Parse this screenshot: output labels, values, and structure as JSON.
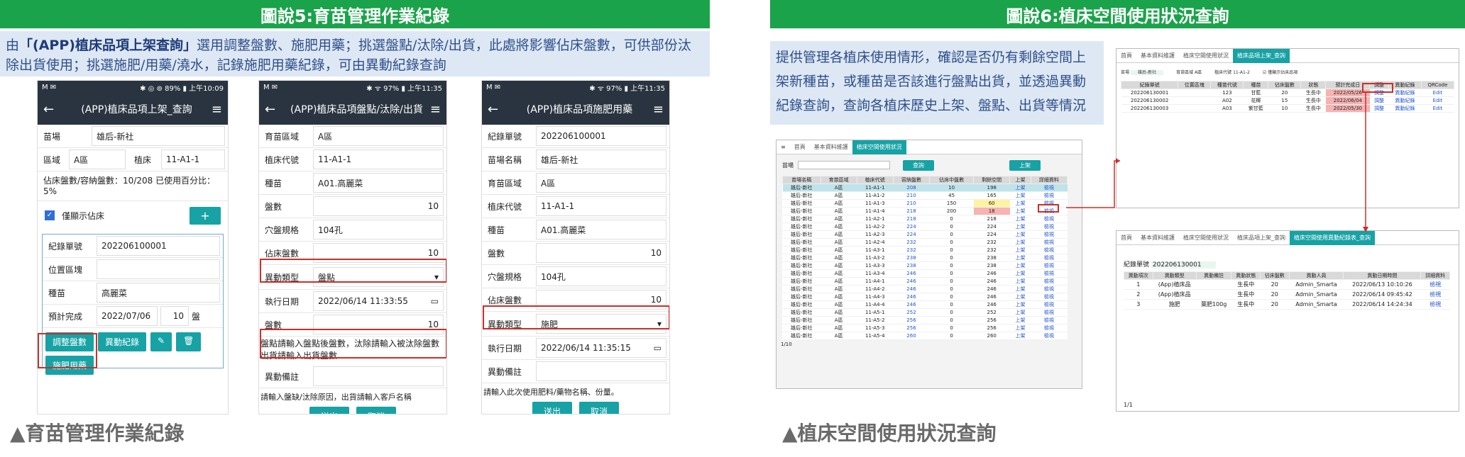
{
  "left": {
    "header": "圖說5:育苗管理作業紀錄",
    "intro_html_pre": "由",
    "intro_bold": "「(APP)植床品項上架查詢」",
    "intro_rest": "選用調整盤數、施肥用藥；挑選盤點/汰除/出貨，此處將影響佔床盤數，可供部份汰除出貨使用；挑選施肥/用藥/澆水，記錄施肥用藥紀錄，可由異動紀錄查詢",
    "caption": "▲育苗管理作業紀錄"
  },
  "right": {
    "header": "圖說6:植床空間使用狀況查詢",
    "intro": "提供管理各植床使用情形，確認是否仍有剩餘空間上架新種苗，或種苗是否該進行盤點出貨，並透過異動紀錄查詢，查詢各植床歷史上架、盤點、出貨等情況",
    "caption": "▲植床空間使用狀況查詢"
  },
  "phone1": {
    "status_left": "M ✉",
    "status_right": "✱ ◎ ⊚ 89% ▮ 上午10:09",
    "title": "(APP)植床品項上架_查詢",
    "farm_label": "苗場",
    "farm": "雄后-新社",
    "zone_label": "區域",
    "zone": "A區",
    "bed_label": "植床",
    "bed": "11-A1-1",
    "usage": "佔床盤數/容納盤數：10/208 已使用百分比：5%",
    "only_label": "僅顯示佔床",
    "plus": "+",
    "rec_label": "紀錄單號",
    "rec": "202206100001",
    "loc_label": "位置區塊",
    "loc": "",
    "seed_label": "種苗",
    "seed": "高麗菜",
    "due_label": "預計完成",
    "due": "2022/07/06",
    "qty": "10",
    "unit": "盤",
    "btn_adjust": "調整盤數",
    "btn_log": "異動紀錄",
    "btn_fert": "施肥用藥",
    "edit_icon": "✎",
    "del_icon": "🗑"
  },
  "phone2": {
    "status_left": "M ✉",
    "status_right": "✱ ᯤ 97% ▮ 上午11:35",
    "title": "(APP)植床品項盤點/汰除/出貨",
    "rows": [
      {
        "l": "育苗區域",
        "v": "A區"
      },
      {
        "l": "植床代號",
        "v": "11-A1-1"
      },
      {
        "l": "種苗",
        "v": "A01.高麗菜"
      },
      {
        "l": "盤數",
        "v": "10"
      },
      {
        "l": "穴盤規格",
        "v": "104孔"
      },
      {
        "l": "佔床盤數",
        "v": "10"
      }
    ],
    "type_label": "異動類型",
    "type": "盤點",
    "date_label": "執行日期",
    "date": "2022/06/14 11:33:55",
    "cnt_label": "盤數",
    "cnt": "10",
    "note": "盤點請輸入盤點後盤數，汰除請輸入被汰除盤數出貨請輸入出貨盤數",
    "memo_label": "異動備註",
    "hint": "請輸入盤缺/汰除原因，出貨請輸入客戶名稱",
    "submit": "送出",
    "cancel": "取消"
  },
  "phone3": {
    "status_left": "M ✉",
    "status_right": "✱ ᯤ 97% ▮ 上午11:35",
    "title": "(APP)植床品項施肥用藥",
    "rows": [
      {
        "l": "紀錄單號",
        "v": "202206100001"
      },
      {
        "l": "苗場名稱",
        "v": "雄后-新社"
      },
      {
        "l": "育苗區域",
        "v": "A區"
      },
      {
        "l": "植床代號",
        "v": "11-A1-1"
      },
      {
        "l": "種苗",
        "v": "A01.高麗菜"
      },
      {
        "l": "盤數",
        "v": "10"
      },
      {
        "l": "穴盤規格",
        "v": "104孔"
      },
      {
        "l": "佔床盤數",
        "v": "10"
      }
    ],
    "type_label": "異動類型",
    "type": "施肥",
    "date_label": "執行日期",
    "date": "2022/06/14 11:35:15",
    "memo_label": "異動備註",
    "hint": "請輸入此次使用肥料/藥物名稱、份量。",
    "submit": "送出",
    "cancel": "取消"
  },
  "grid": {
    "tab1": "首頁",
    "tab2": "基本資料維護",
    "tab3": "植床空間使用狀況",
    "field": "苗場",
    "query": "查詢",
    "shelf": "上架",
    "cols": [
      "苗場名稱",
      "育苗區域",
      "植床代號",
      "容納盤數",
      "佔床中盤數",
      "剩餘空間",
      "上架",
      "詳細資料"
    ],
    "rows": [
      [
        "雄后-新社",
        "A區",
        "11-A1-1",
        "208",
        "10",
        "198"
      ],
      [
        "雄后-新社",
        "A區",
        "11-A1-2",
        "210",
        "45",
        "165"
      ],
      [
        "雄后-新社",
        "A區",
        "11-A1-3",
        "210",
        "150",
        "60"
      ],
      [
        "雄后-新社",
        "A區",
        "11-A1-4",
        "218",
        "200",
        "18"
      ],
      [
        "雄后-新社",
        "A區",
        "11-A2-1",
        "218",
        "0",
        "218"
      ],
      [
        "雄后-新社",
        "A區",
        "11-A2-2",
        "224",
        "0",
        "224"
      ],
      [
        "雄后-新社",
        "A區",
        "11-A2-3",
        "224",
        "0",
        "224"
      ],
      [
        "雄后-新社",
        "A區",
        "11-A2-4",
        "232",
        "0",
        "232"
      ],
      [
        "雄后-新社",
        "A區",
        "11-A3-1",
        "232",
        "0",
        "232"
      ],
      [
        "雄后-新社",
        "A區",
        "11-A3-2",
        "238",
        "0",
        "238"
      ],
      [
        "雄后-新社",
        "A區",
        "11-A3-3",
        "238",
        "0",
        "238"
      ],
      [
        "雄后-新社",
        "A區",
        "11-A3-4",
        "246",
        "0",
        "246"
      ],
      [
        "雄后-新社",
        "A區",
        "11-A4-1",
        "246",
        "0",
        "246"
      ],
      [
        "雄后-新社",
        "A區",
        "11-A4-2",
        "246",
        "0",
        "246"
      ],
      [
        "雄后-新社",
        "A區",
        "11-A4-3",
        "246",
        "0",
        "246"
      ],
      [
        "雄后-新社",
        "A區",
        "11-A4-4",
        "246",
        "0",
        "246"
      ],
      [
        "雄后-新社",
        "A區",
        "11-A5-1",
        "252",
        "0",
        "252"
      ],
      [
        "雄后-新社",
        "A區",
        "11-A5-2",
        "256",
        "0",
        "256"
      ],
      [
        "雄后-新社",
        "A區",
        "11-A5-3",
        "256",
        "0",
        "256"
      ],
      [
        "雄后-新社",
        "A區",
        "11-A5-4",
        "260",
        "0",
        "260"
      ]
    ],
    "shelf_link": "上架",
    "detail_link": "檢視",
    "pager": "1/10"
  },
  "mid": {
    "tabs": [
      "首頁",
      "基本資料維護",
      "植床空間使用狀況",
      "植床品項上架_查詢"
    ],
    "f1": "苗場",
    "v1": "雄后-新社",
    "f2": "育苗區域",
    "v2": "A區",
    "f3": "植床代號",
    "v3": "11-A1-2",
    "chk": "僅顯示佔床品項",
    "cols": [
      "紀錄單號",
      "位置區塊",
      "種苗代號",
      "種苗",
      "佔床盤數",
      "狀態",
      "預計完成日",
      "調整",
      "異動紀錄",
      "QRCode"
    ],
    "rows": [
      [
        "202206130001",
        "",
        "123",
        "甘藍",
        "20",
        "生長中",
        "2022/05/26",
        "調整",
        "異動紀錄",
        "Edit"
      ],
      [
        "202206130002",
        "",
        "A02",
        "花椰",
        "15",
        "生長中",
        "2022/06/04",
        "調整",
        "異動紀錄",
        "Edit"
      ],
      [
        "202206130003",
        "",
        "A03",
        "紫甘藍",
        "10",
        "生長中",
        "2022/05/30",
        "調整",
        "異動紀錄",
        "Edit"
      ]
    ]
  },
  "log": {
    "tabs": [
      "首頁",
      "基本資料維護",
      "植床空間使用狀況",
      "植床品項上架_查詢",
      "植床空間使用異動紀錄表_查詢"
    ],
    "rec_label": "紀錄單號",
    "rec": "202206130001",
    "cols": [
      "異動項次",
      "異動類型",
      "異動備註",
      "異動狀態",
      "佔床盤數",
      "異動人員",
      "異動日期時間",
      "詳細資料"
    ],
    "rows": [
      [
        "1",
        "(App)植床品",
        "",
        "生長中",
        "20",
        "Admin_Smarta",
        "2022/06/13 10:10:26",
        "檢視"
      ],
      [
        "2",
        "(App)植床品",
        "",
        "生長中",
        "20",
        "Admin_Smarta",
        "2022/06/14 09:45:42",
        "檢視"
      ],
      [
        "3",
        "施肥",
        "葉肥100g",
        "生長中",
        "20",
        "Admin_Smarta",
        "2022/06/14 14:24:34",
        "檢視"
      ]
    ],
    "pager": "1/1"
  }
}
